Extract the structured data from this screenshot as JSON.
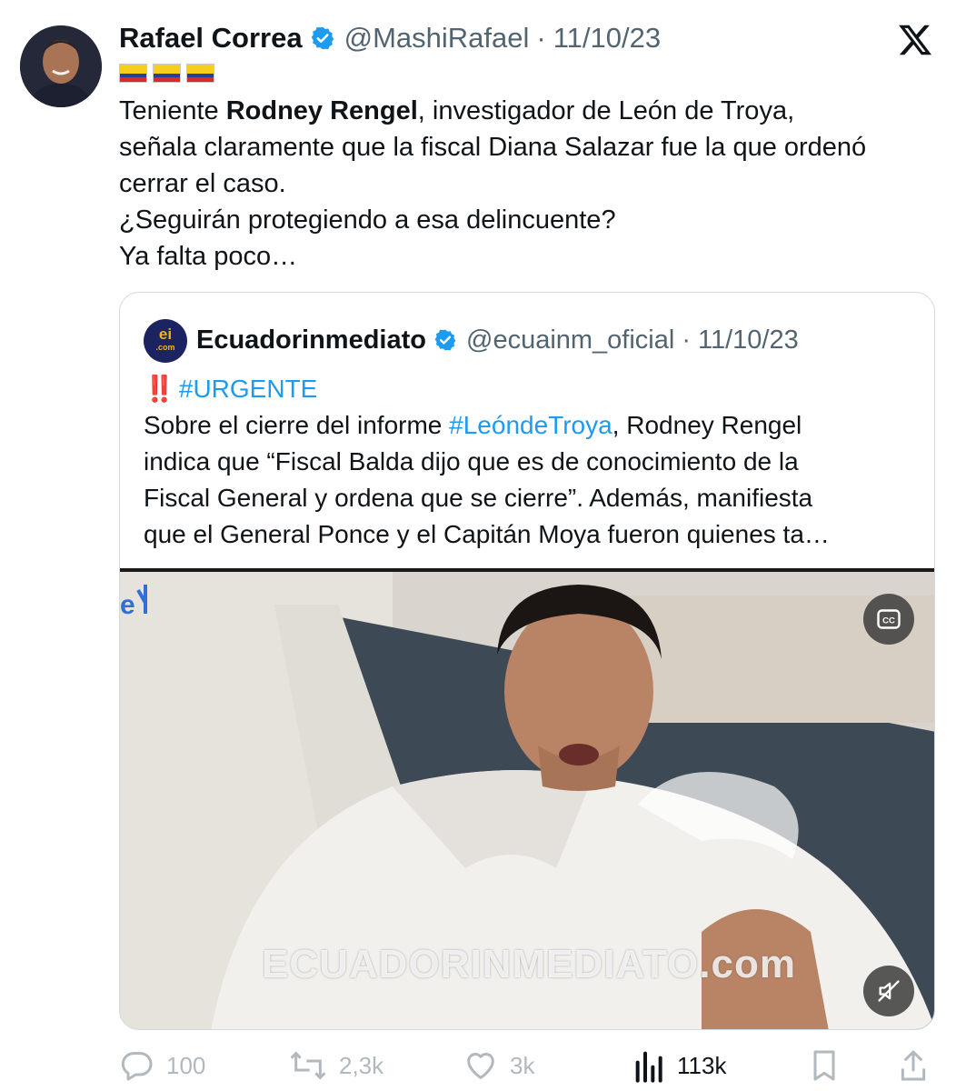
{
  "tweet": {
    "author_name": "Rafael Correa",
    "handle": "@MashiRafael",
    "separator": "·",
    "date": "11/10/23",
    "flag_count": 3,
    "text": {
      "l1_pre": "Teniente ",
      "l1_bold": "Rodney Rengel",
      "l1_post": ", investigador de León de Troya,",
      "l2": "señala claramente que la fiscal Diana Salazar fue la que ordenó",
      "l3": "cerrar el caso.",
      "l4": "¿Seguirán protegiendo a esa delincuente?",
      "l5": "Ya falta poco…"
    }
  },
  "quote": {
    "author_name": "Ecuadorinmediato",
    "handle": "@ecuainm_oficial",
    "separator": "·",
    "date": "11/10/23",
    "avatar_text": "ei",
    "avatar_sub": ".com",
    "text": {
      "l1_bang": "‼️",
      "l1_tag": "#URGENTE",
      "l2_pre": "Sobre el cierre del informe ",
      "l2_tag": "#LeóndeTroya",
      "l2_post": ", Rodney Rengel",
      "l3": "indica que “Fiscal Balda dijo que es de conocimiento de la",
      "l4": "Fiscal General y ordena que se cierre”. Además, manifiesta",
      "l5": "que el General Ponce y el Capitán Moya fueron quienes ta…"
    },
    "media": {
      "watermark": "ECUADORINMEDIATO.com",
      "cc_label": "CC"
    }
  },
  "actions": {
    "replies": "100",
    "reposts": "2,3k",
    "likes": "3k",
    "views": "113k"
  },
  "colors": {
    "text": "#0f1419",
    "muted": "#536471",
    "link": "#1d9bf0",
    "verified": "#1d9bf0",
    "border": "#cfd9de"
  }
}
